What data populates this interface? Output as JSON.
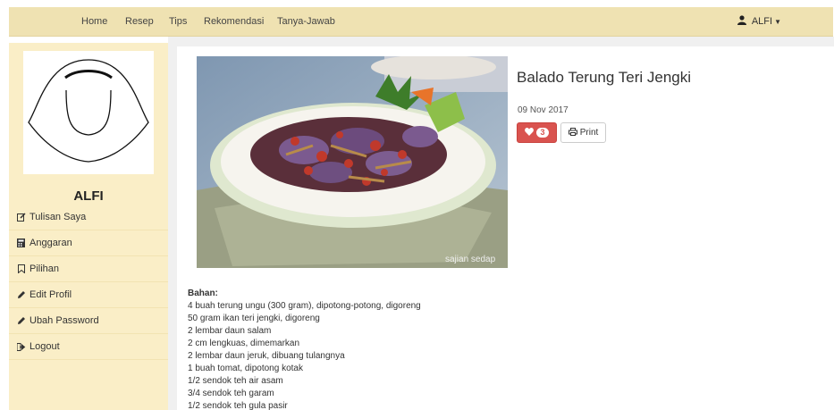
{
  "nav": {
    "items": [
      "Home",
      "Resep",
      "Tips",
      "Rekomendasi",
      "Tanya-Jawab"
    ],
    "user_label": "ALFI"
  },
  "sidebar": {
    "name": "ALFI",
    "items": [
      {
        "label": "Tulisan Saya",
        "icon": "edit-icon"
      },
      {
        "label": "Anggaran",
        "icon": "calculator-icon"
      },
      {
        "label": "Pilihan",
        "icon": "bookmark-icon"
      },
      {
        "label": "Edit Profil",
        "icon": "pencil-icon"
      },
      {
        "label": "Ubah Password",
        "icon": "pencil-icon"
      },
      {
        "label": "Logout",
        "icon": "logout-icon"
      }
    ]
  },
  "recipe": {
    "title": "Balado Terung Teri Jengki",
    "date": "09 Nov 2017",
    "like_count": "3",
    "print_label": "Print",
    "photo_watermark": "sajian sedap",
    "ingredients_heading": "Bahan:",
    "ingredients": [
      "4 buah terung ungu (300 gram), dipotong-potong, digoreng",
      "50 gram ikan teri jengki, digoreng",
      "2 lembar daun salam",
      "2 cm lengkuas, dimemarkan",
      "2 lembar daun jeruk, dibuang tulangnya",
      "1 buah tomat, dipotong kotak",
      "1/2 sendok teh air asam",
      "3/4 sendok teh garam",
      "1/2 sendok teh gula pasir"
    ]
  },
  "colors": {
    "navbar": "#efe2b2",
    "sidebar": "#faeec7",
    "like_button": "#d9534f"
  }
}
